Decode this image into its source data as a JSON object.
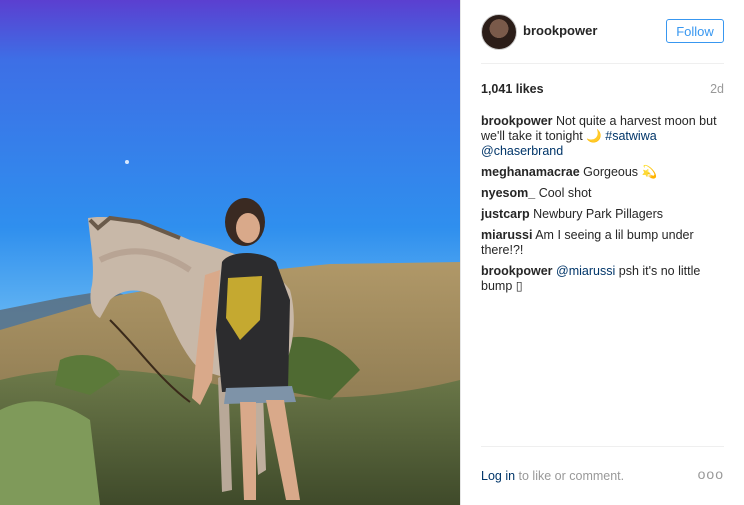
{
  "post": {
    "photo_alt": "Woman standing next to a horse on a hillside",
    "username": "brookpower",
    "follow_label": "Follow",
    "likes": "1,041 likes",
    "age": "2d",
    "caption": {
      "author": "brookpower",
      "text": "Not quite a harvest moon but we'll take it tonight 🌙 ",
      "hashtag": "#satwiwa",
      "mention": "@chaserbrand"
    },
    "comments": [
      {
        "author": "meghanamacrae",
        "text": "Gorgeous 💫"
      },
      {
        "author": "nyesom_",
        "text": "Cool shot"
      },
      {
        "author": "justcarp",
        "text": "Newbury Park Pillagers"
      },
      {
        "author": "miarussi",
        "text": "Am I seeing a lil bump under there!?!"
      }
    ],
    "reply": {
      "author": "brookpower",
      "mention": "@miarussi",
      "text": " psh it's no little bump ▯"
    },
    "footer": {
      "login_label": "Log in",
      "rest": " to like or comment.",
      "more": "ooo"
    }
  },
  "colors": {
    "accent": "#3897f0",
    "link": "#003569",
    "muted": "#999999"
  }
}
